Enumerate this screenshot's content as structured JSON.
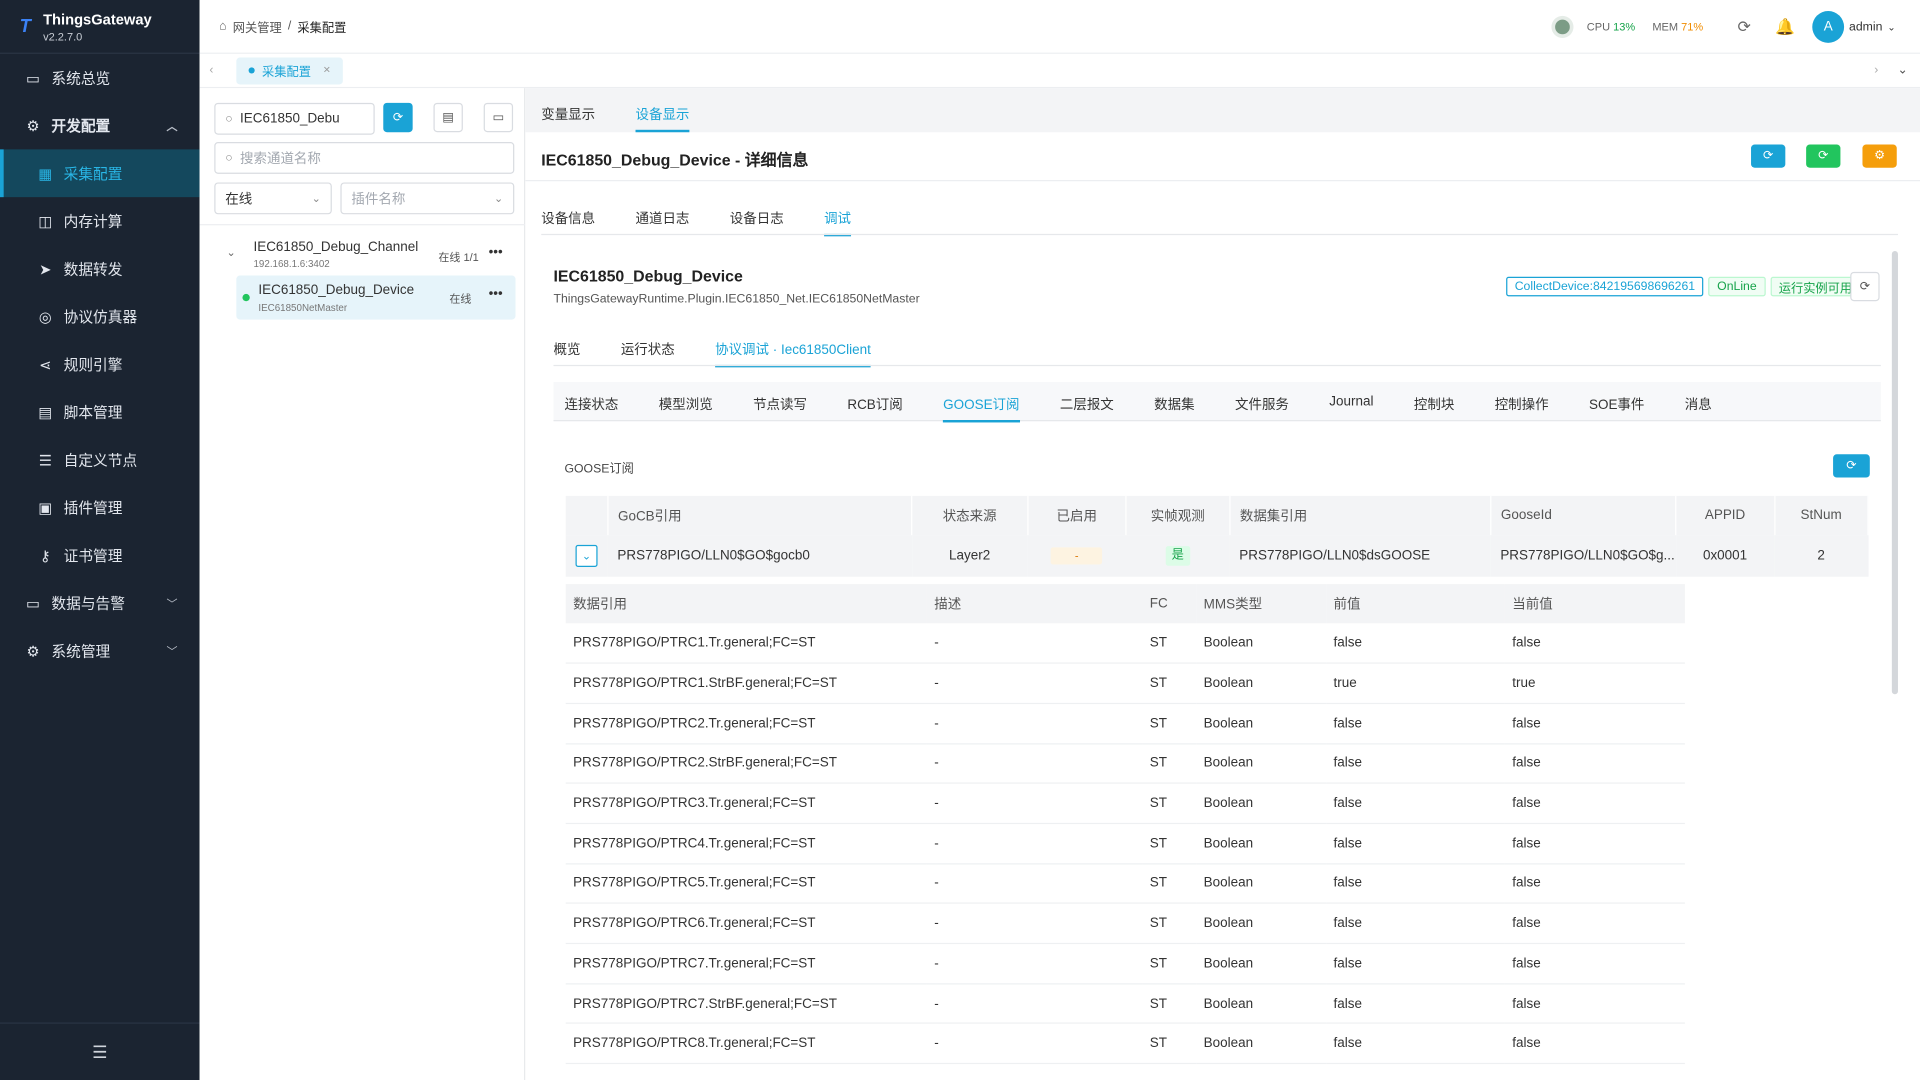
{
  "app": {
    "name": "ThingsGateway",
    "version": "v2.2.7.0"
  },
  "sidebar": {
    "items": [
      {
        "label": "系统总览",
        "icon": "monitor-icon",
        "type": "top"
      },
      {
        "label": "开发配置",
        "icon": "gear-icon",
        "type": "group"
      },
      {
        "label": "采集配置",
        "icon": "chart-icon",
        "type": "sub",
        "active": true
      },
      {
        "label": "内存计算",
        "icon": "chip-icon",
        "type": "sub"
      },
      {
        "label": "数据转发",
        "icon": "send-icon",
        "type": "sub"
      },
      {
        "label": "协议仿真器",
        "icon": "wifi-icon",
        "type": "sub"
      },
      {
        "label": "规则引擎",
        "icon": "share-icon",
        "type": "sub"
      },
      {
        "label": "脚本管理",
        "icon": "file-icon",
        "type": "sub"
      },
      {
        "label": "自定义节点",
        "icon": "sliders-icon",
        "type": "sub"
      },
      {
        "label": "插件管理",
        "icon": "puzzle-icon",
        "type": "sub"
      },
      {
        "label": "证书管理",
        "icon": "key-icon",
        "type": "sub"
      },
      {
        "label": "数据与告警",
        "icon": "screen-icon",
        "type": "top"
      },
      {
        "label": "系统管理",
        "icon": "cog-icon",
        "type": "top"
      }
    ]
  },
  "header": {
    "breadcrumb": [
      "网关管理",
      "采集配置"
    ],
    "cpu_label": "CPU",
    "cpu": "13%",
    "mem_label": "MEM",
    "mem": "71%",
    "user_initial": "A",
    "user": "admin"
  },
  "pagetabs": [
    {
      "label": "采集配置"
    }
  ],
  "left": {
    "search_value": "IEC61850_Debu",
    "channel_search_placeholder": "搜索通道名称",
    "status_filter": "在线",
    "plugin_placeholder": "插件名称",
    "channel": {
      "name": "IEC61850_Debug_Channel",
      "addr": "192.168.1.6:3402",
      "status": "在线 1/1"
    },
    "device": {
      "name": "IEC61850_Debug_Device",
      "plugin": "IEC61850NetMaster",
      "status": "在线"
    }
  },
  "main": {
    "top_tabs": [
      "变量显示",
      "设备显示"
    ],
    "detail_title": "IEC61850_Debug_Device - 详细信息",
    "detail_tabs": [
      "设备信息",
      "通道日志",
      "设备日志",
      "调试"
    ],
    "device_name": "IEC61850_Debug_Device",
    "device_class": "ThingsGatewayRuntime.Plugin.IEC61850_Net.IEC61850NetMaster",
    "badges": {
      "collect": "CollectDevice:842195698696261",
      "online": "OnLine",
      "run": "运行实例可用"
    },
    "sub_tabs": [
      "概览",
      "运行状态",
      "协议调试 · Iec61850Client"
    ],
    "proto_tabs": [
      "连接状态",
      "模型浏览",
      "节点读写",
      "RCB订阅",
      "GOOSE订阅",
      "二层报文",
      "数据集",
      "文件服务",
      "Journal",
      "控制块",
      "控制操作",
      "SOE事件",
      "消息"
    ],
    "goose_title": "GOOSE订阅",
    "goose_headers": [
      "GoCB引用",
      "状态来源",
      "已启用",
      "实帧观测",
      "数据集引用",
      "GooseId",
      "APPID",
      "StNum"
    ],
    "goose_row": {
      "gocb": "PRS778PIGO/LLN0$GO$gocb0",
      "source": "Layer2",
      "enabled": "-",
      "observed": "是",
      "dataset": "PRS778PIGO/LLN0$dsGOOSE",
      "gooseid": "PRS778PIGO/LLN0$GO$g...",
      "appid": "0x0001",
      "stnum": "2"
    },
    "data_headers": [
      "数据引用",
      "描述",
      "FC",
      "MMS类型",
      "前值",
      "当前值"
    ],
    "data_rows": [
      [
        "PRS778PIGO/PTRC1.Tr.general;FC=ST",
        "-",
        "ST",
        "Boolean",
        "false",
        "false"
      ],
      [
        "PRS778PIGO/PTRC1.StrBF.general;FC=ST",
        "-",
        "ST",
        "Boolean",
        "true",
        "true"
      ],
      [
        "PRS778PIGO/PTRC2.Tr.general;FC=ST",
        "-",
        "ST",
        "Boolean",
        "false",
        "false"
      ],
      [
        "PRS778PIGO/PTRC2.StrBF.general;FC=ST",
        "-",
        "ST",
        "Boolean",
        "false",
        "false"
      ],
      [
        "PRS778PIGO/PTRC3.Tr.general;FC=ST",
        "-",
        "ST",
        "Boolean",
        "false",
        "false"
      ],
      [
        "PRS778PIGO/PTRC4.Tr.general;FC=ST",
        "-",
        "ST",
        "Boolean",
        "false",
        "false"
      ],
      [
        "PRS778PIGO/PTRC5.Tr.general;FC=ST",
        "-",
        "ST",
        "Boolean",
        "false",
        "false"
      ],
      [
        "PRS778PIGO/PTRC6.Tr.general;FC=ST",
        "-",
        "ST",
        "Boolean",
        "false",
        "false"
      ],
      [
        "PRS778PIGO/PTRC7.Tr.general;FC=ST",
        "-",
        "ST",
        "Boolean",
        "false",
        "false"
      ],
      [
        "PRS778PIGO/PTRC7.StrBF.general;FC=ST",
        "-",
        "ST",
        "Boolean",
        "false",
        "false"
      ],
      [
        "PRS778PIGO/PTRC8.Tr.general;FC=ST",
        "-",
        "ST",
        "Boolean",
        "false",
        "false"
      ]
    ]
  },
  "colors": {
    "accent": "#1aa3d6",
    "sidebar_bg": "#1b2431",
    "green": "#22c55e",
    "orange": "#f59e0b"
  }
}
